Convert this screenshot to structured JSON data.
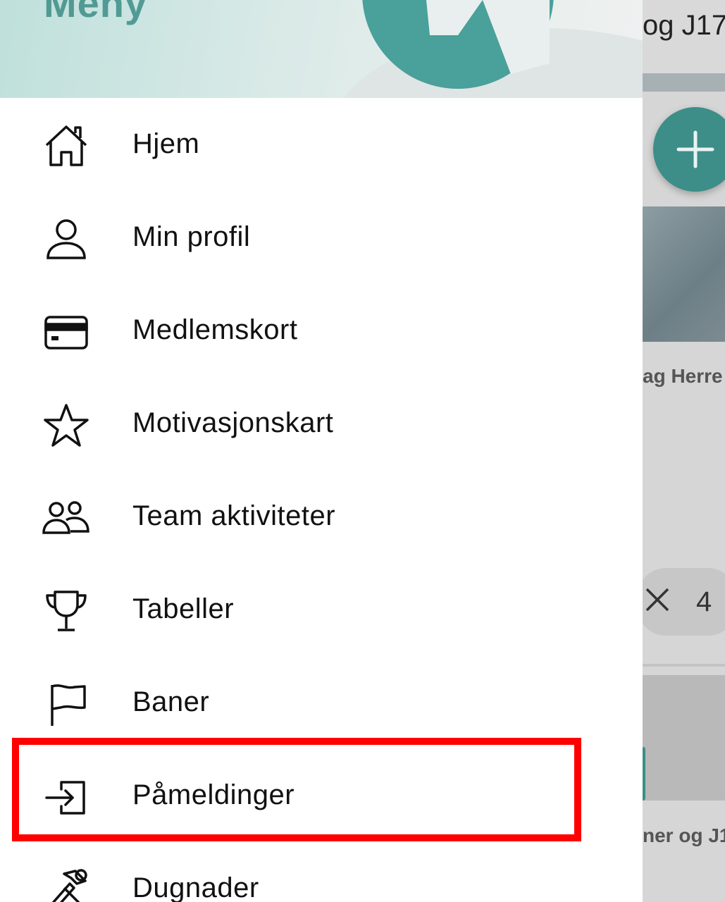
{
  "background": {
    "header_text": "og J17",
    "card_title_1": "ag Herre",
    "chip_count": "4",
    "card_title_2": "ner og J1"
  },
  "drawer": {
    "title": "Meny",
    "accent_color": "#3d8e88",
    "highlight_color": "#ff0000",
    "items": [
      {
        "label": "Hjem",
        "icon": "home-icon"
      },
      {
        "label": "Min profil",
        "icon": "user-icon"
      },
      {
        "label": "Medlemskort",
        "icon": "credit-card-icon"
      },
      {
        "label": "Motivasjonskart",
        "icon": "star-icon"
      },
      {
        "label": "Team aktiviteter",
        "icon": "team-icon"
      },
      {
        "label": "Tabeller",
        "icon": "trophy-icon"
      },
      {
        "label": "Baner",
        "icon": "flag-icon"
      },
      {
        "label": "Påmeldinger",
        "icon": "sign-in-icon"
      },
      {
        "label": "Dugnader",
        "icon": "tools-icon"
      }
    ]
  }
}
